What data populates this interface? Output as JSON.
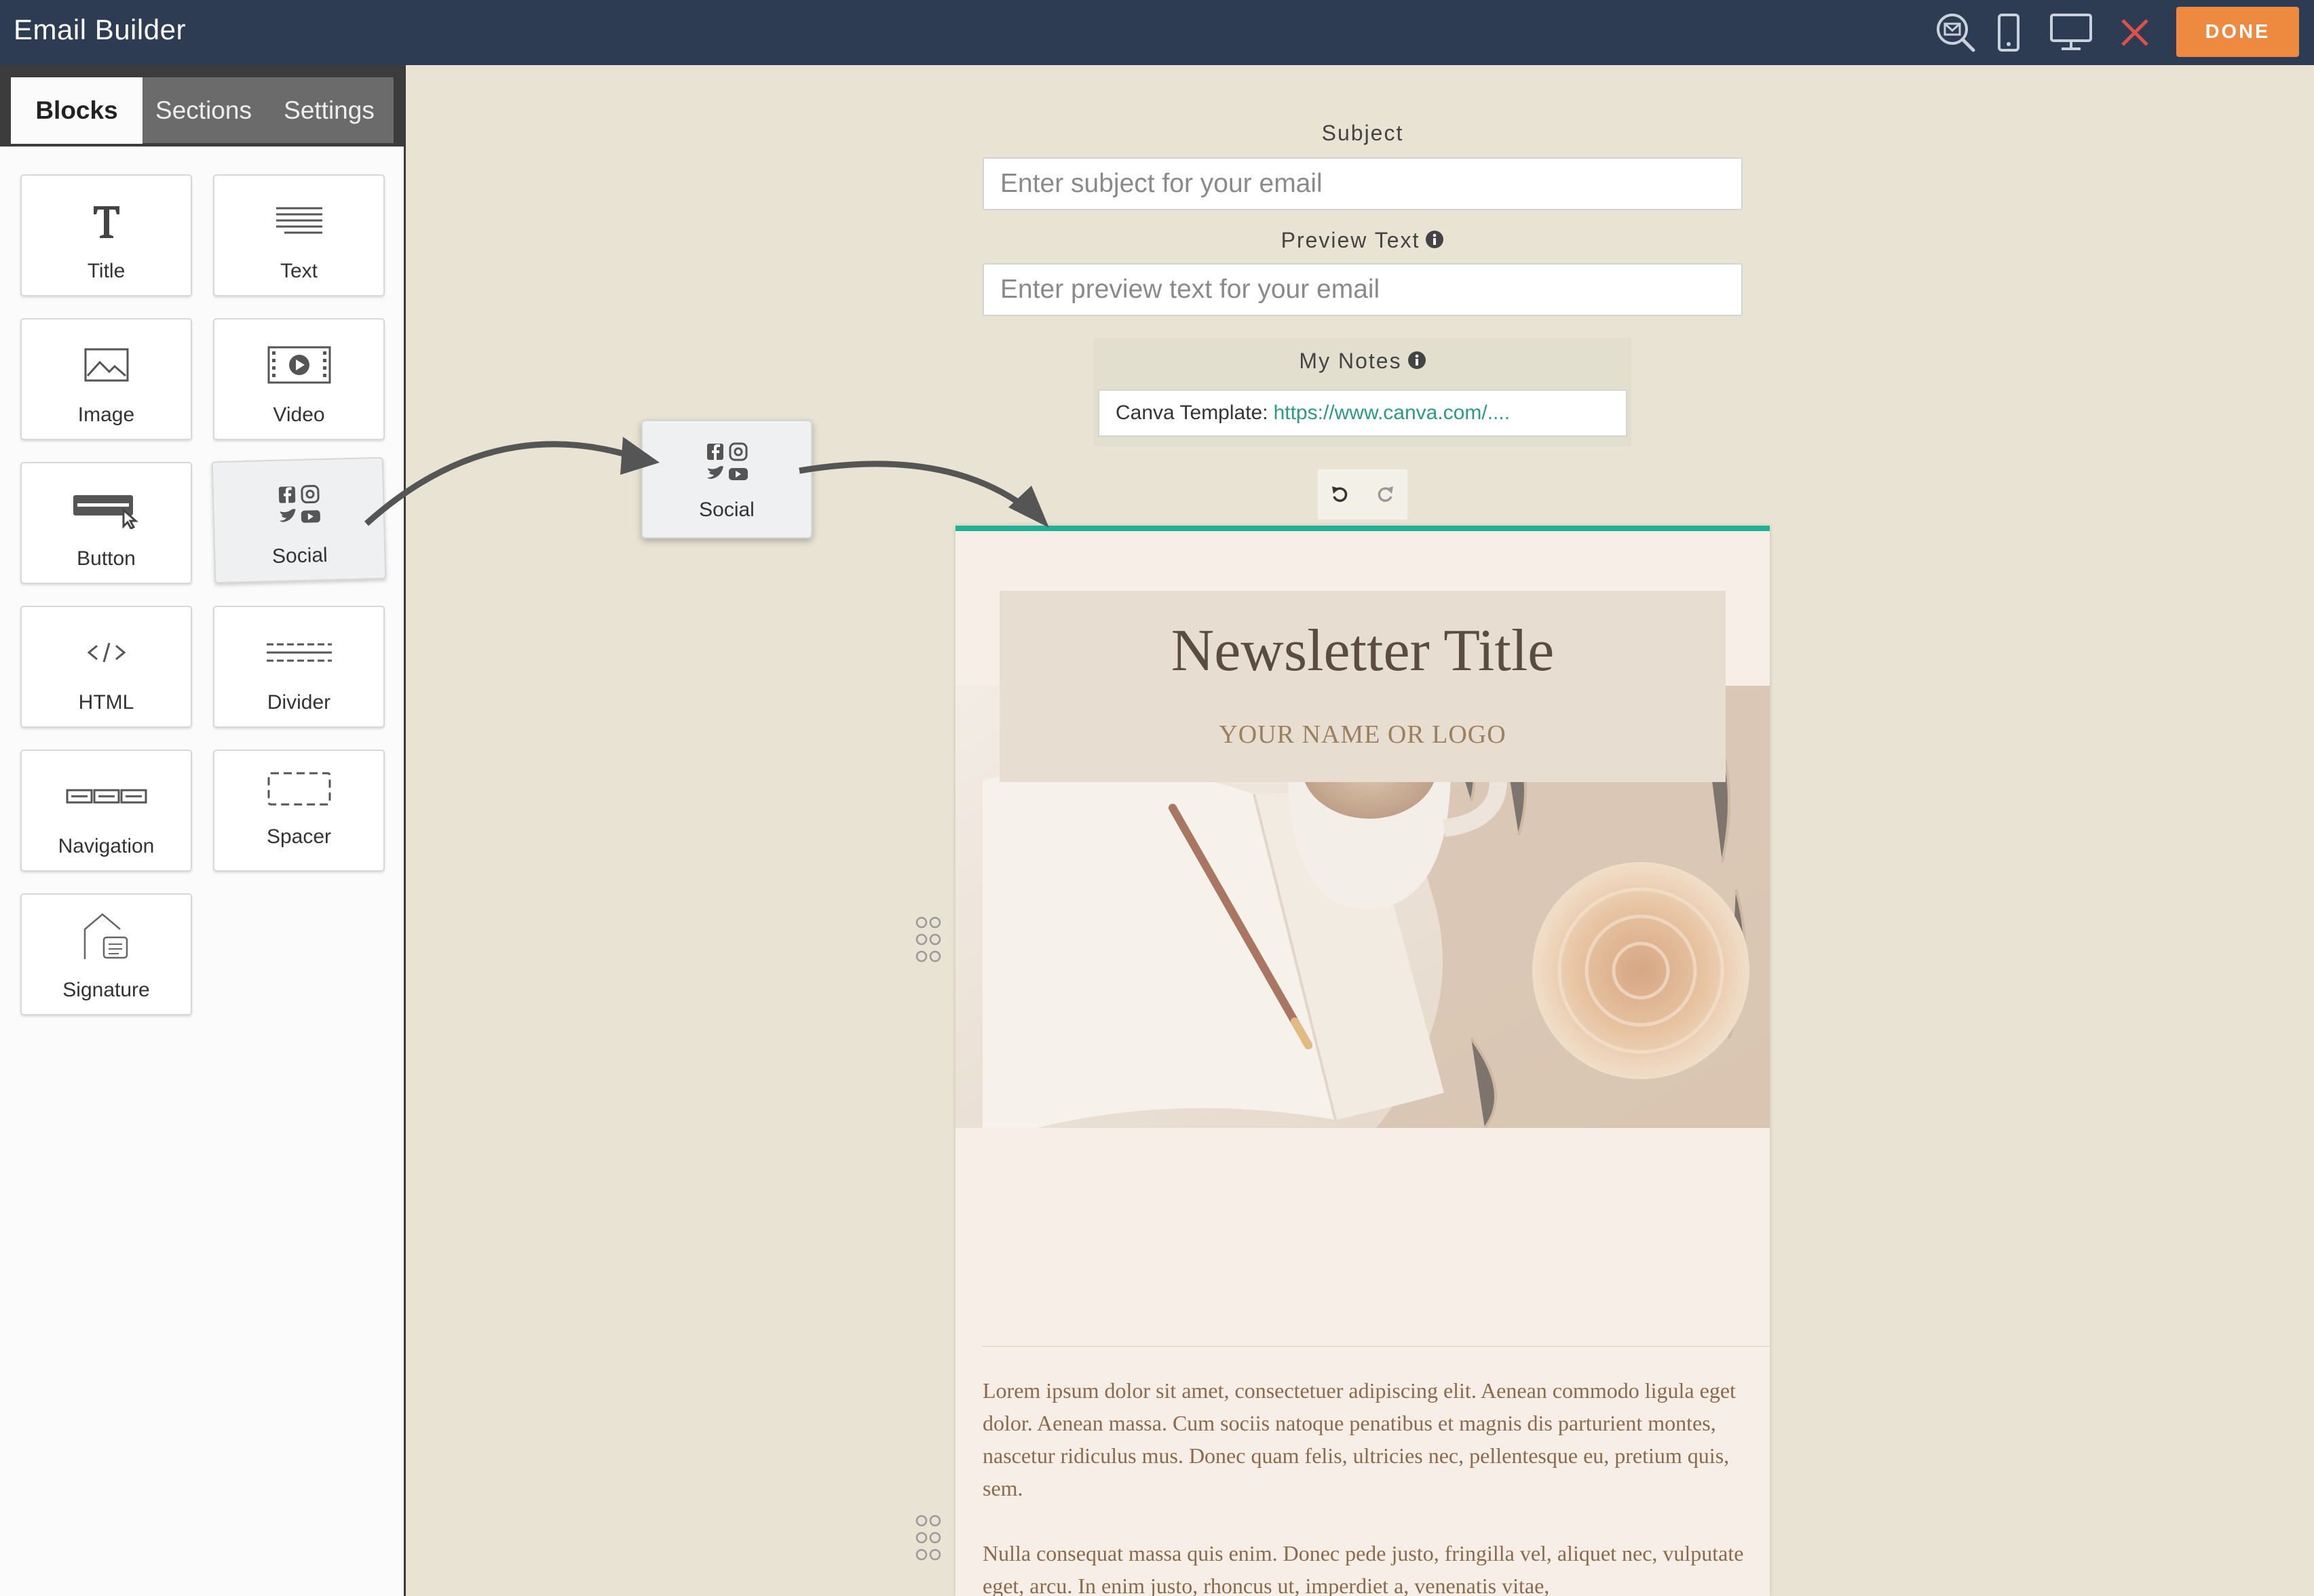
{
  "header": {
    "title": "Email Builder",
    "done_label": "DONE",
    "icons": [
      "preview-email-icon",
      "mobile-icon",
      "desktop-icon",
      "close-icon"
    ]
  },
  "panel": {
    "tabs": [
      {
        "label": "Blocks",
        "active": true
      },
      {
        "label": "Sections",
        "active": false
      },
      {
        "label": "Settings",
        "active": false
      }
    ],
    "blocks": [
      {
        "label": "Title",
        "icon": "title-icon"
      },
      {
        "label": "Text",
        "icon": "text-icon"
      },
      {
        "label": "Image",
        "icon": "image-icon"
      },
      {
        "label": "Video",
        "icon": "video-icon"
      },
      {
        "label": "Button",
        "icon": "button-icon"
      },
      {
        "label": "Social",
        "icon": "social-icon"
      },
      {
        "label": "HTML",
        "icon": "html-icon"
      },
      {
        "label": "Divider",
        "icon": "divider-icon"
      },
      {
        "label": "Navigation",
        "icon": "navigation-icon"
      },
      {
        "label": "Spacer",
        "icon": "spacer-icon"
      },
      {
        "label": "Signature",
        "icon": "signature-icon"
      }
    ]
  },
  "drag": {
    "label": "Social"
  },
  "form": {
    "subject_label": "Subject",
    "subject_placeholder": "Enter subject for your email",
    "preview_label": "Preview Text",
    "preview_placeholder": "Enter preview text for your email",
    "notes_label": "My Notes",
    "notes_prefix": "Canva Template:",
    "notes_link": "https://www.canva.com/...."
  },
  "email": {
    "title": "Newsletter Title",
    "logo": "YOUR NAME OR LOGO",
    "paragraph1": "Lorem ipsum dolor sit amet, consectetuer adipiscing elit. Aenean commodo ligula eget dolor. Aenean massa. Cum sociis natoque penatibus et magnis dis parturient montes, nascetur ridiculus mus. Donec quam felis, ultricies nec, pellentesque eu, pretium quis, sem.",
    "paragraph2": "Nulla consequat massa quis enim. Donec pede justo, fringilla vel, aliquet nec, vulputate eget, arcu. In enim justo, rhoncus ut, imperdiet a, venenatis vitae,"
  },
  "colors": {
    "topbar": "#2d3c52",
    "accent_done": "#ee8a3f",
    "drop_indicator": "#1fb196",
    "canvas_bg": "#e8e3d3",
    "close_icon": "#e0504a"
  }
}
